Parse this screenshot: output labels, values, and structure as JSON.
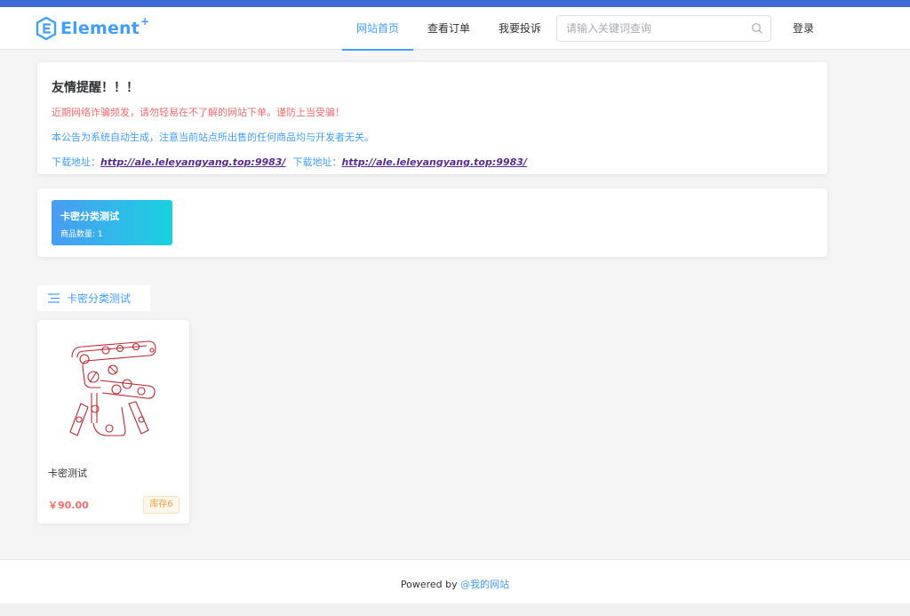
{
  "header": {
    "logo_text": "Element",
    "logo_plus": "+",
    "nav": [
      {
        "label": "网站首页",
        "active": true
      },
      {
        "label": "查看订单",
        "active": false
      },
      {
        "label": "我要投诉",
        "active": false
      }
    ],
    "search_placeholder": "请输入关键词查询",
    "login_label": "登录"
  },
  "notice": {
    "title": "友情提醒！！！",
    "line_warning": "近期网络诈骗频发，请勿轻易在不了解的网站下单。谨防上当受骗！",
    "line_info": "本公告为系统自动生成，注意当前站点所出售的任何商品均与开发者无关。",
    "download_label_1": "下载地址：",
    "download_url_1": "http://ale.leleyangyang.top:9983/",
    "download_label_2": "下载地址：",
    "download_url_2": "http://ale.leleyangyang.top:9983/"
  },
  "categories": [
    {
      "name": "卡密分类测试",
      "count_text": "商品数量: 1"
    }
  ],
  "section": {
    "tab_label": "卡密分类测试"
  },
  "products": [
    {
      "name": "卡密测试",
      "price": "￥90.00",
      "stock": "库存6"
    }
  ],
  "footer": {
    "prefix": "Powered by ",
    "link": "@我的网站"
  },
  "colors": {
    "accent": "#409eff",
    "danger": "#f56c6c",
    "warning": "#e6a23c",
    "header_strip": "#3d6bd6"
  }
}
